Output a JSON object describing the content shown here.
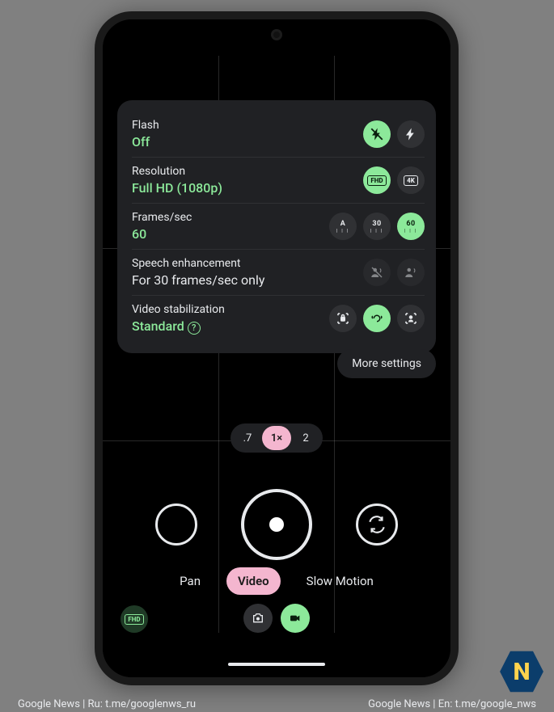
{
  "settings": {
    "flash": {
      "title": "Flash",
      "value": "Off"
    },
    "res": {
      "title": "Resolution",
      "value": "Full HD (1080p)",
      "opts": {
        "fhd": "FHD",
        "uhd": "4K"
      }
    },
    "fps": {
      "title": "Frames/sec",
      "value": "60",
      "opts": {
        "auto": "A",
        "thirty": "30",
        "sixty": "60"
      }
    },
    "speech": {
      "title": "Speech enhancement",
      "value": "For 30 frames/sec only"
    },
    "stab": {
      "title": "Video stabilization",
      "value": "Standard"
    }
  },
  "more_label": "More settings",
  "zoom": {
    "wide": ".7",
    "one": "1×",
    "two": "2"
  },
  "modes": {
    "pan": "Pan",
    "video": "Video",
    "slow": "Slow Motion"
  },
  "badge": "FHD",
  "watermark": "N",
  "credit": {
    "left": "Google News | Ru: t.me/googlenws_ru",
    "right": "Google News | En: t.me/google_nws"
  }
}
